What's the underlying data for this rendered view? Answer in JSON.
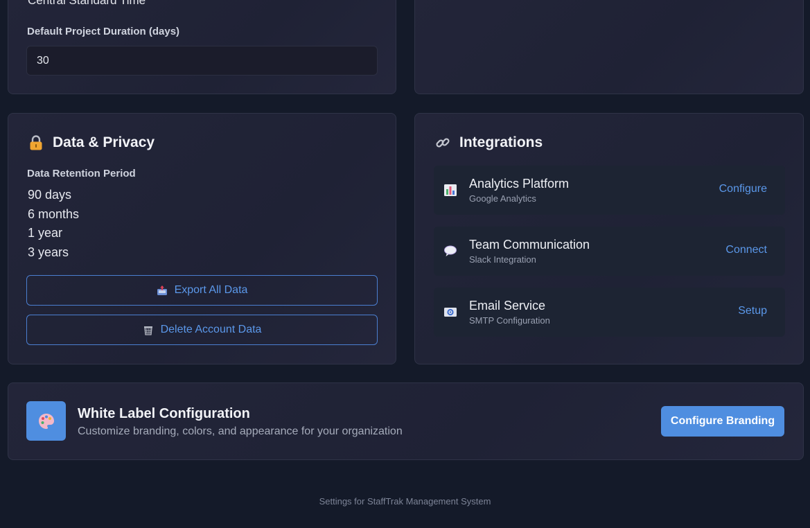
{
  "general": {
    "timezone_value": "Central Standard Time",
    "duration_label": "Default Project Duration (days)",
    "duration_value": "30"
  },
  "privacy": {
    "icon": "lock-icon",
    "title": "Data & Privacy",
    "retention_label": "Data Retention Period",
    "retention_options": [
      "90 days",
      "6 months",
      "1 year",
      "3 years"
    ],
    "export_label": "Export All Data",
    "export_icon": "outbox-icon",
    "delete_label": "Delete Account Data",
    "delete_icon": "trash-icon"
  },
  "integrations": {
    "icon": "link-icon",
    "title": "Integrations",
    "items": [
      {
        "name": "Analytics Platform",
        "sub": "Google Analytics",
        "action": "Configure",
        "icon": "bar-chart-icon"
      },
      {
        "name": "Team Communication",
        "sub": "Slack Integration",
        "action": "Connect",
        "icon": "chat-bubble-icon"
      },
      {
        "name": "Email Service",
        "sub": "SMTP Configuration",
        "action": "Setup",
        "icon": "email-icon"
      }
    ]
  },
  "whitelabel": {
    "icon": "palette-icon",
    "title": "White Label Configuration",
    "subtitle": "Customize branding, colors, and appearance for your organization",
    "button_label": "Configure Branding"
  },
  "footer": {
    "text": "Settings for StaffTrak Management System"
  },
  "colors": {
    "accent": "#4f8ee0",
    "link": "#5b98ea",
    "background": "#141a29",
    "card": "#222438"
  }
}
